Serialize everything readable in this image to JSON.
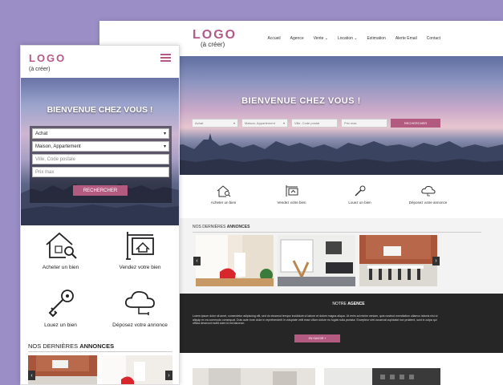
{
  "desktop": {
    "logo": "LOGO",
    "logo_sub": "(à créer)",
    "nav": [
      "Accueil",
      "Agence",
      "Vente ⌄",
      "Location ⌄",
      "Estimation",
      "Alerte Email",
      "Contact"
    ],
    "hero_title": "BIENVENUE CHEZ VOUS !",
    "search": {
      "type": "Achat",
      "property": "Maison, Appartement",
      "city_placeholder": "Ville, Code postal",
      "price_placeholder": "Prix max",
      "button": "RECHERCHER"
    },
    "services": [
      "Acheter un bien",
      "Vendez votre bien",
      "Louez un bien",
      "Déposez votre annonce"
    ],
    "annonces": {
      "prefix": "NOS DERNIÈRES ",
      "bold": "ANNONCES"
    },
    "agency": {
      "prefix": "NOTRE ",
      "bold": "AGENCE",
      "text": "Lorem ipsum dolor sit amet, consectetur adipiscing elit, sed do eiusmod tempor incididunt ut labore et dolore magna aliqua. Ut enim ad minim veniam, quis nostrud exercitation ullamco laboris nisi ut aliquip ex ea commodo consequat. Duis aute irure dolor in reprehenderit in voluptate velit esse cillum dolore eu fugiat nulla pariatur. Excepteur sint occaecat cupidatat non proident, sunt in culpa qui officia deserunt mollit anim id est laborum.",
      "button": "EN SAVOIR +"
    }
  },
  "mobile": {
    "logo": "LOGO",
    "logo_sub": "(à créer)",
    "hero_title": "BIENVENUE CHEZ VOUS !",
    "search": {
      "type": "Achat",
      "property": "Maison, Appartement",
      "city_placeholder": "Ville, Code postale",
      "price_placeholder": "Prix max",
      "button": "RECHERCHER"
    },
    "services": [
      "Acheter un bien",
      "Vendez votre bien",
      "Louez un bien",
      "Déposez votre annonce"
    ],
    "annonces": {
      "prefix": "NOS DERNIÈRES ",
      "bold": "ANNONCES"
    }
  },
  "icons": [
    "house-search-icon",
    "for-sale-sign-icon",
    "key-icon",
    "cloud-upload-icon",
    "chevron-down-icon",
    "arrow-left-icon",
    "arrow-right-icon",
    "hamburger-menu-icon"
  ],
  "colors": {
    "background": "#9b8ec6",
    "brand": "#b35a80",
    "dark": "#262626"
  }
}
